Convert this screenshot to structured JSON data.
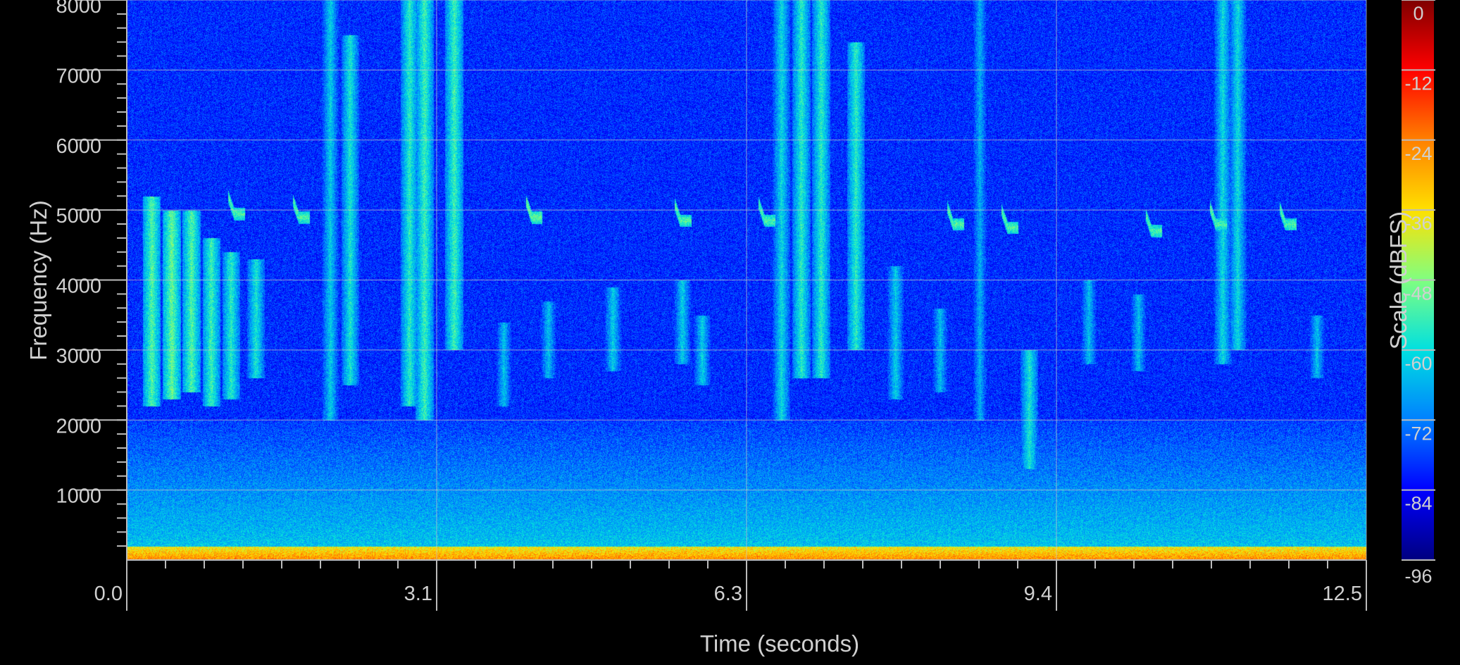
{
  "chart_data": {
    "type": "heatmap",
    "title": "",
    "xlabel": "Time (seconds)",
    "ylabel": "Frequency (Hz)",
    "colorbar_label": "Scale (dBFS)",
    "xlim": [
      0.0,
      12.5
    ],
    "ylim": [
      0,
      8000
    ],
    "zlim": [
      -96,
      0
    ],
    "x_ticks": [
      {
        "value": 0.0,
        "label": "0.0"
      },
      {
        "value": 3.125,
        "label": "3.1"
      },
      {
        "value": 6.25,
        "label": "6.3"
      },
      {
        "value": 9.375,
        "label": "9.4"
      },
      {
        "value": 12.5,
        "label": "12.5"
      }
    ],
    "y_ticks": [
      {
        "value": 1000,
        "label": "1000"
      },
      {
        "value": 2000,
        "label": "2000"
      },
      {
        "value": 3000,
        "label": "3000"
      },
      {
        "value": 4000,
        "label": "4000"
      },
      {
        "value": 5000,
        "label": "5000"
      },
      {
        "value": 6000,
        "label": "6000"
      },
      {
        "value": 7000,
        "label": "7000"
      },
      {
        "value": 8000,
        "label": "8000"
      }
    ],
    "colorbar_ticks": [
      {
        "value": 0,
        "label": "0"
      },
      {
        "value": -12,
        "label": "-12"
      },
      {
        "value": -24,
        "label": "-24"
      },
      {
        "value": -36,
        "label": "-36"
      },
      {
        "value": -48,
        "label": "-48"
      },
      {
        "value": -60,
        "label": "-60"
      },
      {
        "value": -72,
        "label": "-72"
      },
      {
        "value": -84,
        "label": "-84"
      },
      {
        "value": -96,
        "label": "-96"
      }
    ],
    "grid": true,
    "colormap": "jet",
    "colormap_stops": [
      "#00007f",
      "#0000ff",
      "#0080ff",
      "#00e0e0",
      "#80ff80",
      "#ffe000",
      "#ff8000",
      "#ff0000",
      "#7f0000"
    ],
    "background_level_db": -80,
    "low_frequency_band": {
      "freq_max": 200,
      "level_db": -25
    },
    "broadband_noise": {
      "freq_max": 2000,
      "level_db": -62
    },
    "vertical_bursts": [
      {
        "time": 0.25,
        "freq_low": 2200,
        "freq_high": 5200,
        "level_db": -52
      },
      {
        "time": 0.45,
        "freq_low": 2300,
        "freq_high": 5000,
        "level_db": -50
      },
      {
        "time": 0.65,
        "freq_low": 2400,
        "freq_high": 5000,
        "level_db": -52
      },
      {
        "time": 0.85,
        "freq_low": 2200,
        "freq_high": 4600,
        "level_db": -54
      },
      {
        "time": 1.05,
        "freq_low": 2300,
        "freq_high": 4400,
        "level_db": -56
      },
      {
        "time": 1.3,
        "freq_low": 2600,
        "freq_high": 4300,
        "level_db": -58
      },
      {
        "time": 2.05,
        "freq_low": 2000,
        "freq_high": 8000,
        "level_db": -62
      },
      {
        "time": 2.25,
        "freq_low": 2500,
        "freq_high": 7500,
        "level_db": -58
      },
      {
        "time": 2.85,
        "freq_low": 2200,
        "freq_high": 8000,
        "level_db": -56
      },
      {
        "time": 3.0,
        "freq_low": 2000,
        "freq_high": 8000,
        "level_db": -54
      },
      {
        "time": 3.3,
        "freq_low": 3000,
        "freq_high": 8000,
        "level_db": -54
      },
      {
        "time": 3.8,
        "freq_low": 2200,
        "freq_high": 3400,
        "level_db": -64
      },
      {
        "time": 4.25,
        "freq_low": 2600,
        "freq_high": 3700,
        "level_db": -64
      },
      {
        "time": 4.9,
        "freq_low": 2700,
        "freq_high": 3900,
        "level_db": -62
      },
      {
        "time": 5.6,
        "freq_low": 2800,
        "freq_high": 4000,
        "level_db": -62
      },
      {
        "time": 5.8,
        "freq_low": 2500,
        "freq_high": 3500,
        "level_db": -62
      },
      {
        "time": 6.6,
        "freq_low": 2000,
        "freq_high": 8000,
        "level_db": -60
      },
      {
        "time": 6.8,
        "freq_low": 2600,
        "freq_high": 8000,
        "level_db": -56
      },
      {
        "time": 7.0,
        "freq_low": 2600,
        "freq_high": 8000,
        "level_db": -56
      },
      {
        "time": 7.35,
        "freq_low": 3000,
        "freq_high": 7400,
        "level_db": -56
      },
      {
        "time": 7.75,
        "freq_low": 2300,
        "freq_high": 4200,
        "level_db": -62
      },
      {
        "time": 8.2,
        "freq_low": 2400,
        "freq_high": 3600,
        "level_db": -64
      },
      {
        "time": 8.6,
        "freq_low": 2000,
        "freq_high": 8000,
        "level_db": -66
      },
      {
        "time": 9.1,
        "freq_low": 1300,
        "freq_high": 3000,
        "level_db": -58
      },
      {
        "time": 9.7,
        "freq_low": 2800,
        "freq_high": 4000,
        "level_db": -64
      },
      {
        "time": 10.2,
        "freq_low": 2700,
        "freq_high": 3800,
        "level_db": -64
      },
      {
        "time": 11.05,
        "freq_low": 2800,
        "freq_high": 8000,
        "level_db": -60
      },
      {
        "time": 11.2,
        "freq_low": 3000,
        "freq_high": 8000,
        "level_db": -60
      },
      {
        "time": 12.0,
        "freq_low": 2600,
        "freq_high": 3500,
        "level_db": -64
      }
    ],
    "chirps": [
      {
        "time": 1.05,
        "freq": 4950,
        "level_db": -52
      },
      {
        "time": 1.7,
        "freq": 4900,
        "level_db": -52
      },
      {
        "time": 4.05,
        "freq": 4900,
        "level_db": -50
      },
      {
        "time": 5.55,
        "freq": 4850,
        "level_db": -52
      },
      {
        "time": 6.4,
        "freq": 4850,
        "level_db": -52
      },
      {
        "time": 8.3,
        "freq": 4800,
        "level_db": -52
      },
      {
        "time": 8.85,
        "freq": 4750,
        "level_db": -52
      },
      {
        "time": 10.3,
        "freq": 4700,
        "level_db": -52
      },
      {
        "time": 10.95,
        "freq": 4800,
        "level_db": -52
      },
      {
        "time": 11.65,
        "freq": 4800,
        "level_db": -52
      }
    ]
  }
}
